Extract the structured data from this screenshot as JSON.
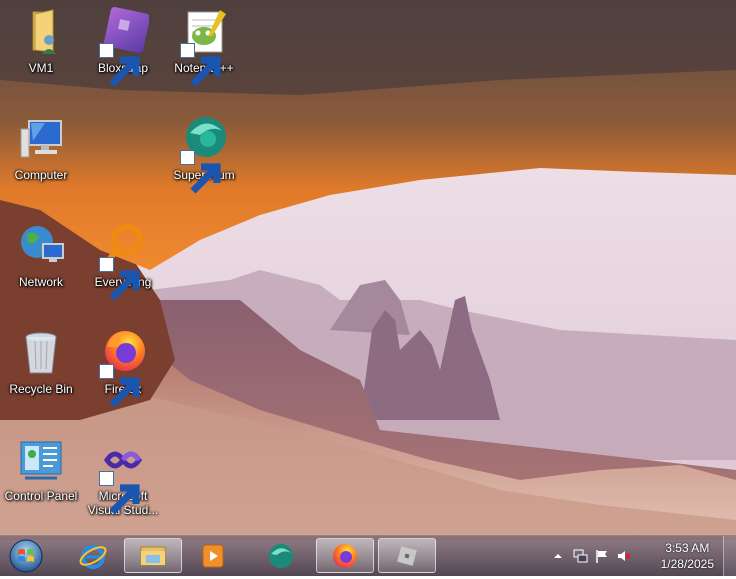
{
  "desktop": {
    "icons": [
      {
        "name": "desktop-icon-vm1",
        "label": "VM1",
        "icon": "folder-user-icon"
      },
      {
        "name": "desktop-icon-bloxstrap",
        "label": "Bloxstrap",
        "icon": "bloxstrap-icon",
        "shortcut": true
      },
      {
        "name": "desktop-icon-notepadpp",
        "label": "Notepad++",
        "icon": "notepadpp-icon",
        "shortcut": true
      },
      {
        "name": "desktop-icon-computer",
        "label": "Computer",
        "icon": "computer-icon"
      },
      {
        "name": "desktop-icon-supermium",
        "label": "Supermium",
        "icon": "supermium-icon",
        "shortcut": true
      },
      {
        "name": "desktop-icon-network",
        "label": "Network",
        "icon": "network-icon"
      },
      {
        "name": "desktop-icon-everything",
        "label": "Everything",
        "icon": "everything-icon",
        "shortcut": true
      },
      {
        "name": "desktop-icon-recycle-bin",
        "label": "Recycle Bin",
        "icon": "recycle-bin-icon"
      },
      {
        "name": "desktop-icon-firefox",
        "label": "Firefox",
        "icon": "firefox-icon",
        "shortcut": true
      },
      {
        "name": "desktop-icon-control-panel",
        "label": "Control Panel",
        "icon": "control-panel-icon"
      },
      {
        "name": "desktop-icon-visual-studio",
        "label": "Microsoft\nVisual Stud...",
        "icon": "visual-studio-icon",
        "shortcut": true
      }
    ]
  },
  "taskbar": {
    "start_icon": "windows-start-icon",
    "pinned": [
      {
        "name": "taskbar-internet-explorer",
        "icon": "internet-explorer-icon",
        "active": false
      },
      {
        "name": "taskbar-file-explorer",
        "icon": "file-explorer-icon",
        "active": true
      },
      {
        "name": "taskbar-media-player",
        "icon": "media-player-icon",
        "active": false
      },
      {
        "name": "taskbar-supermium",
        "icon": "supermium-icon",
        "active": false
      },
      {
        "name": "taskbar-firefox",
        "icon": "firefox-icon",
        "active": true
      },
      {
        "name": "taskbar-roblox",
        "icon": "roblox-icon",
        "active": true
      }
    ],
    "tray": {
      "icons": [
        "show-hidden-icons-icon",
        "network-status-icon",
        "action-center-flag-icon",
        "volume-muted-icon"
      ],
      "time": "3:53 AM",
      "date": "1/28/2025"
    }
  }
}
